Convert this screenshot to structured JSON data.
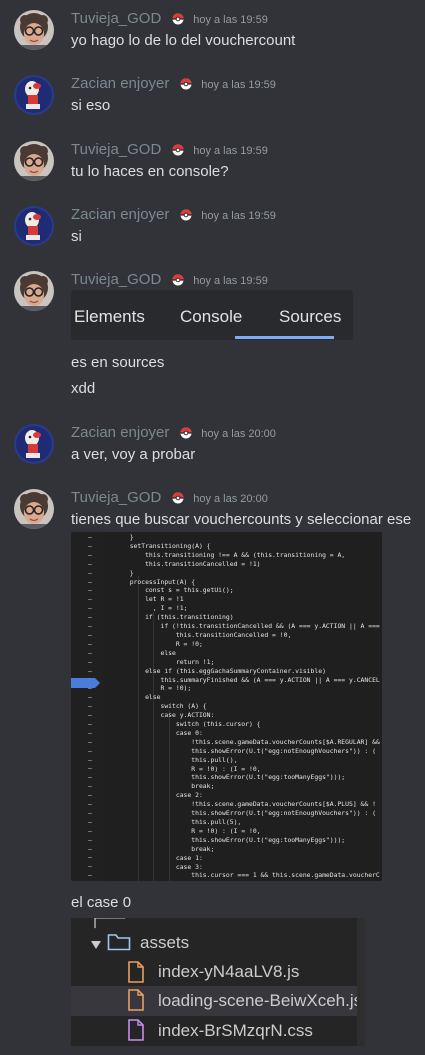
{
  "badge_icon": "pokeball-icon",
  "messages": [
    {
      "user": "Tuvieja_GOD",
      "time": "hoy a las 19:59",
      "text": "yo hago lo de lo del vouchercount"
    },
    {
      "user": "Zacian enjoyer",
      "time": "hoy a las 19:59",
      "text": "si eso"
    },
    {
      "user": "Tuvieja_GOD",
      "time": "hoy a las 19:59",
      "text": "tu lo haces en console?"
    },
    {
      "user": "Zacian enjoyer",
      "time": "hoy a las 19:59",
      "text": "si"
    },
    {
      "user": "Tuvieja_GOD",
      "time": "hoy a las 19:59",
      "lines": [
        "es en sources",
        "xdd"
      ]
    },
    {
      "user": "Zacian enjoyer",
      "time": "hoy a las 20:00",
      "text": "a ver, voy a probar"
    },
    {
      "user": "Tuvieja_GOD",
      "time": "hoy a las 20:00",
      "text": "tienes que buscar vouchercounts y seleccionar ese",
      "after_text": "el case 0"
    }
  ],
  "devtools_tabs": [
    "Elements",
    "Console",
    "Sources"
  ],
  "devtools_selected": "Console",
  "code_lines": [
    "  }",
    "  setTransitioning(A) {",
    "      this.transitioning !== A && (this.transitioning = A,",
    "      this.transitionCancelled = !1)",
    "  }",
    "  processInput(A) {",
    "      const s = this.getUi();",
    "      let R = !1",
    "        , I = !1;",
    "      if (this.transitioning)",
    "          if (!this.transitionCancelled && (A === y.ACTION || A ===",
    "              this.transitionCancelled = !0,",
    "              R = !0;",
    "          else",
    "              return !1;",
    "      else if (this.eggGachaSummaryContainer.visible)",
    "          this.summaryFinished && (A === y.ACTION || A === y.CANCEL",
    "          R = !0);",
    "      else",
    "          switch (A) {",
    "          case y.ACTION:",
    "              switch (this.cursor) {",
    "              case 0:",
    "                  !this.scene.gameData.voucherCounts[$A.REGULAR] &&",
    "                  this.showError(U.t(\"egg:notEnoughVouchers\")) : (",
    "                  this.pull(),",
    "                  R = !0) : (I = !0,",
    "                  this.showError(U.t(\"egg:tooManyEggs\")));",
    "                  break;",
    "              case 2:",
    "                  !this.scene.gameData.voucherCounts[$A.PLUS] && !",
    "                  this.showError(U.t(\"egg:notEnoughVouchers\")) : (",
    "                  this.pull(5),",
    "                  R = !0) : (I = !0,",
    "                  this.showError(U.t(\"egg:tooManyEggs\")));",
    "                  break;",
    "              case 1:",
    "              case 3:",
    "                  this.cursor === 1 && this.scene.gameData.voucherC",
    "                  this.showError(U.t(\"egg:notEnoughVouchers\")))"
  ],
  "file_tree": {
    "folder": "assets",
    "files": [
      {
        "name": "index-yN4aaLV8.js",
        "icon": "js-file-icon",
        "selected": false
      },
      {
        "name": "loading-scene-BeiwXceh.js",
        "icon": "js-file-icon",
        "selected": true
      },
      {
        "name": "index-BrSMzqrN.css",
        "icon": "css-file-icon",
        "selected": false
      }
    ]
  },
  "colors": {
    "background": "#313338",
    "username": "#7e8890",
    "timestamp": "#949ba4",
    "text": "#dbdee1",
    "tab_underline": "#7cacf8",
    "code_bg": "#1f1f1f",
    "tree_bg": "#252526",
    "tree_selected": "#37373d"
  }
}
